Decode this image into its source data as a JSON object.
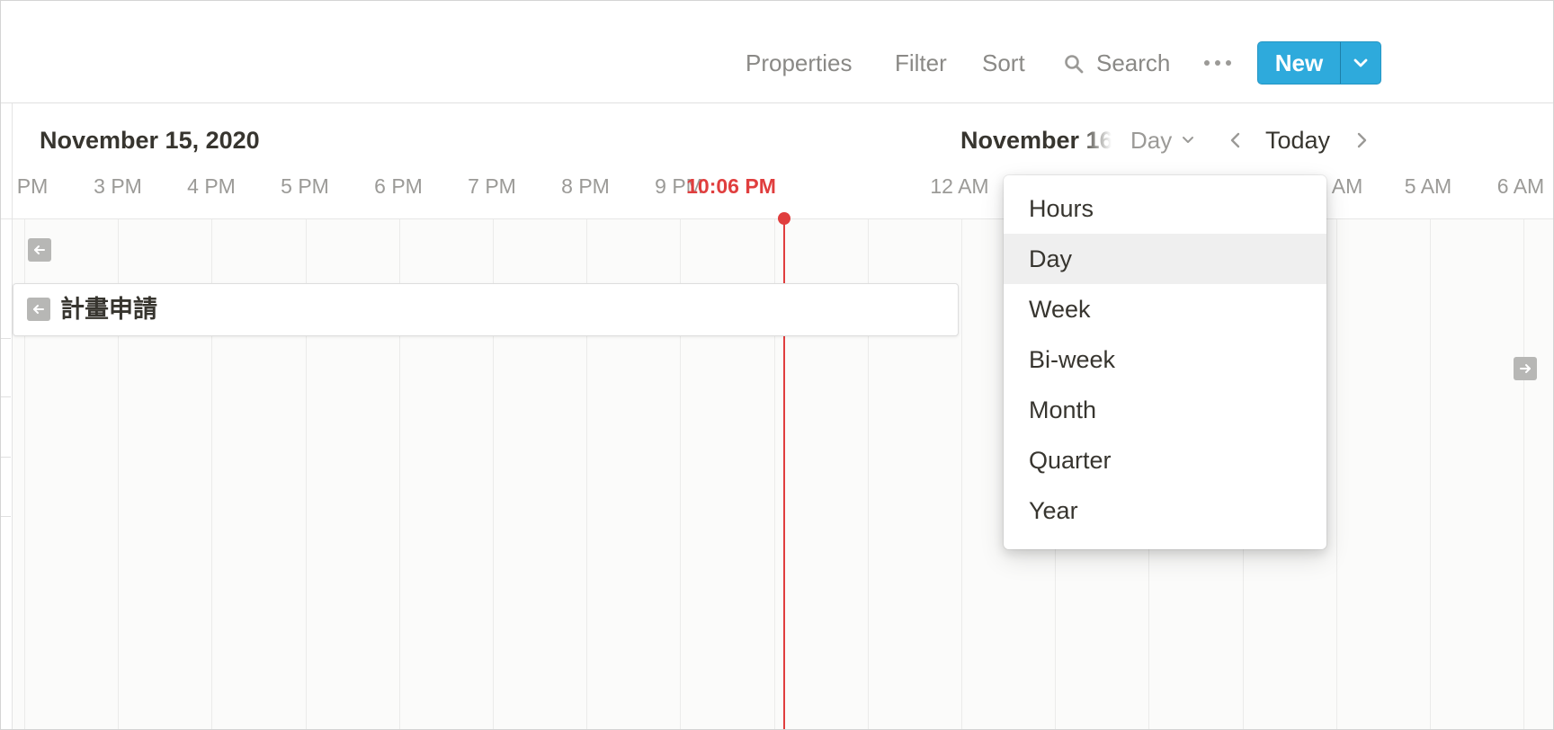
{
  "toolbar": {
    "properties": "Properties",
    "filter": "Filter",
    "sort": "Sort",
    "search": "Search",
    "new_label": "New",
    "icons": [
      "search-icon",
      "more-icon",
      "chevron-down-icon"
    ]
  },
  "timeline": {
    "current_date": "November 15, 2020",
    "next_date": "November 16",
    "view": "Day",
    "today": "Today",
    "hours": [
      "PM",
      "3 PM",
      "4 PM",
      "5 PM",
      "6 PM",
      "7 PM",
      "8 PM",
      "9 PM",
      "12 AM",
      "AM",
      "5 AM",
      "6 AM"
    ],
    "now_label": "10:06 PM"
  },
  "task": {
    "title": "計畫申請"
  },
  "view_menu": {
    "selected": "Day",
    "options": [
      "Hours",
      "Day",
      "Week",
      "Bi-week",
      "Month",
      "Quarter",
      "Year"
    ]
  },
  "colors": {
    "accent": "#2eaadc",
    "now_indicator": "#e03e3e",
    "text": "#37352f",
    "muted": "#9b9a97"
  }
}
